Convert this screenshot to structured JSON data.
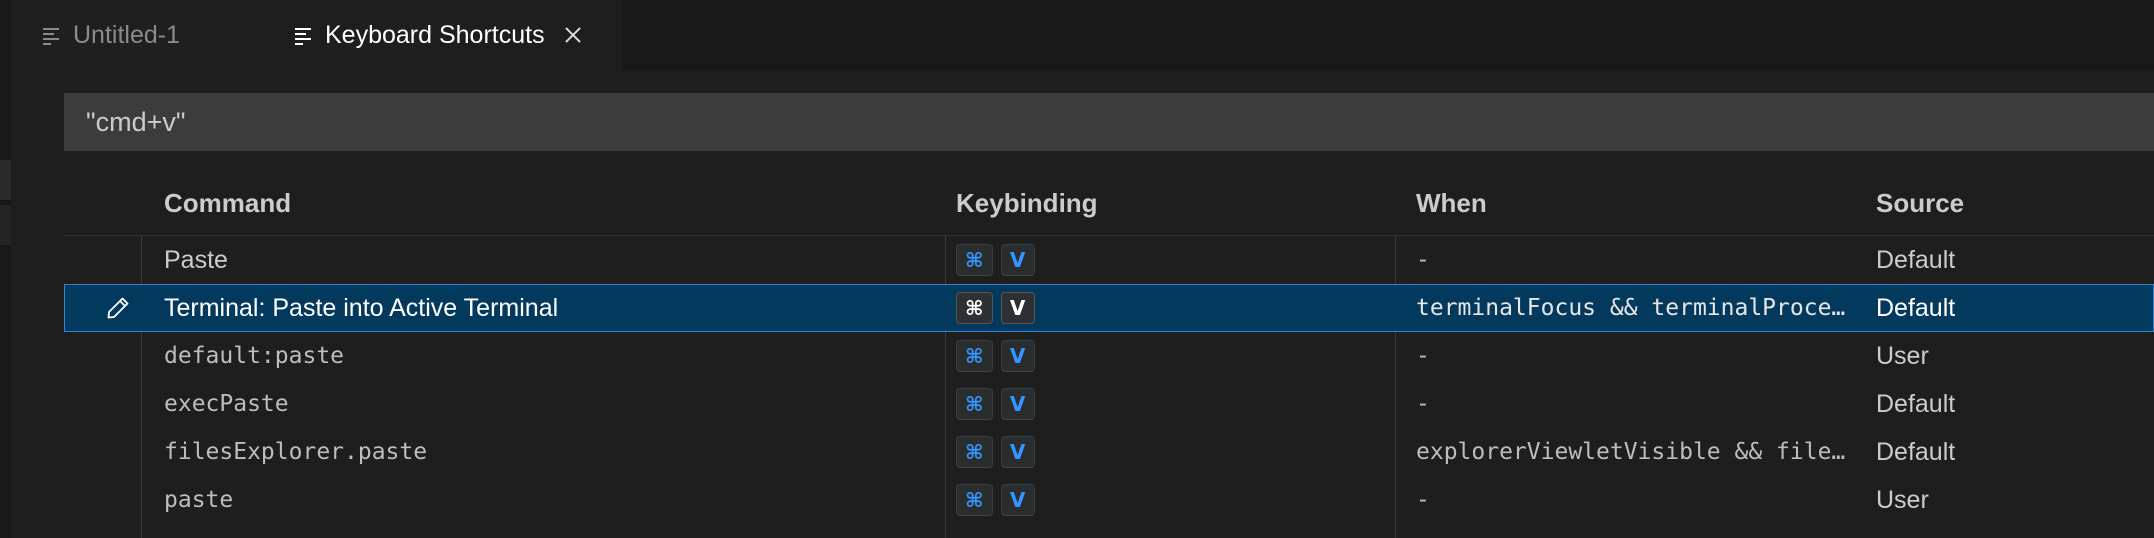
{
  "tabs": [
    {
      "label": "Untitled-1"
    },
    {
      "label": "Keyboard Shortcuts"
    }
  ],
  "search": {
    "value": "\"cmd+v\""
  },
  "table": {
    "headers": {
      "command": "Command",
      "keybinding": "Keybinding",
      "when": "When",
      "source": "Source"
    },
    "rows": [
      {
        "command": "Paste",
        "keys": [
          "⌘",
          "V"
        ],
        "when": "-",
        "source": "Default"
      },
      {
        "command": "Terminal: Paste into Active Terminal",
        "keys": [
          "⌘",
          "V"
        ],
        "when": "terminalFocus && terminalProce…",
        "source": "Default"
      },
      {
        "command": "default:paste",
        "keys": [
          "⌘",
          "V"
        ],
        "when": "-",
        "source": "User"
      },
      {
        "command": "execPaste",
        "keys": [
          "⌘",
          "V"
        ],
        "when": "-",
        "source": "Default"
      },
      {
        "command": "filesExplorer.paste",
        "keys": [
          "⌘",
          "V"
        ],
        "when": "explorerViewletVisible && file…",
        "source": "Default"
      },
      {
        "command": "paste",
        "keys": [
          "⌘",
          "V"
        ],
        "when": "-",
        "source": "User"
      }
    ]
  },
  "icons": {
    "tab": "file-lines-icon",
    "close": "close-icon",
    "edit": "pencil-icon"
  },
  "colors": {
    "selected_row": "#04395e",
    "key_accent": "#3794ff",
    "background": "#1e1e1e"
  }
}
